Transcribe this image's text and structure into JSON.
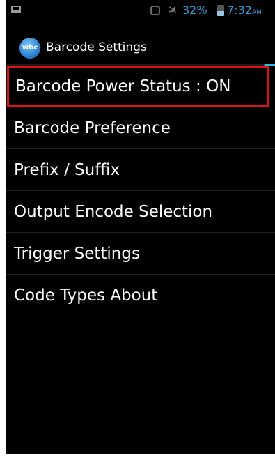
{
  "status_bar": {
    "battery_percent": "32%",
    "time": "7:32",
    "ampm": "AM",
    "icons": [
      "screenshot-icon",
      "rotate-icon",
      "airplane-mode-icon",
      "battery-icon"
    ],
    "accent_color": "#2f9ad6"
  },
  "action_bar": {
    "app_icon_text": "wbc",
    "title": "Barcode Settings"
  },
  "menu": {
    "items": [
      {
        "label": "Barcode Power Status : ON",
        "highlighted": true
      },
      {
        "label": "Barcode Preference"
      },
      {
        "label": "Prefix / Suffix"
      },
      {
        "label": "Output Encode Selection"
      },
      {
        "label": "Trigger Settings"
      },
      {
        "label": "Code Types About"
      }
    ],
    "highlight_color": "#e0101a"
  }
}
